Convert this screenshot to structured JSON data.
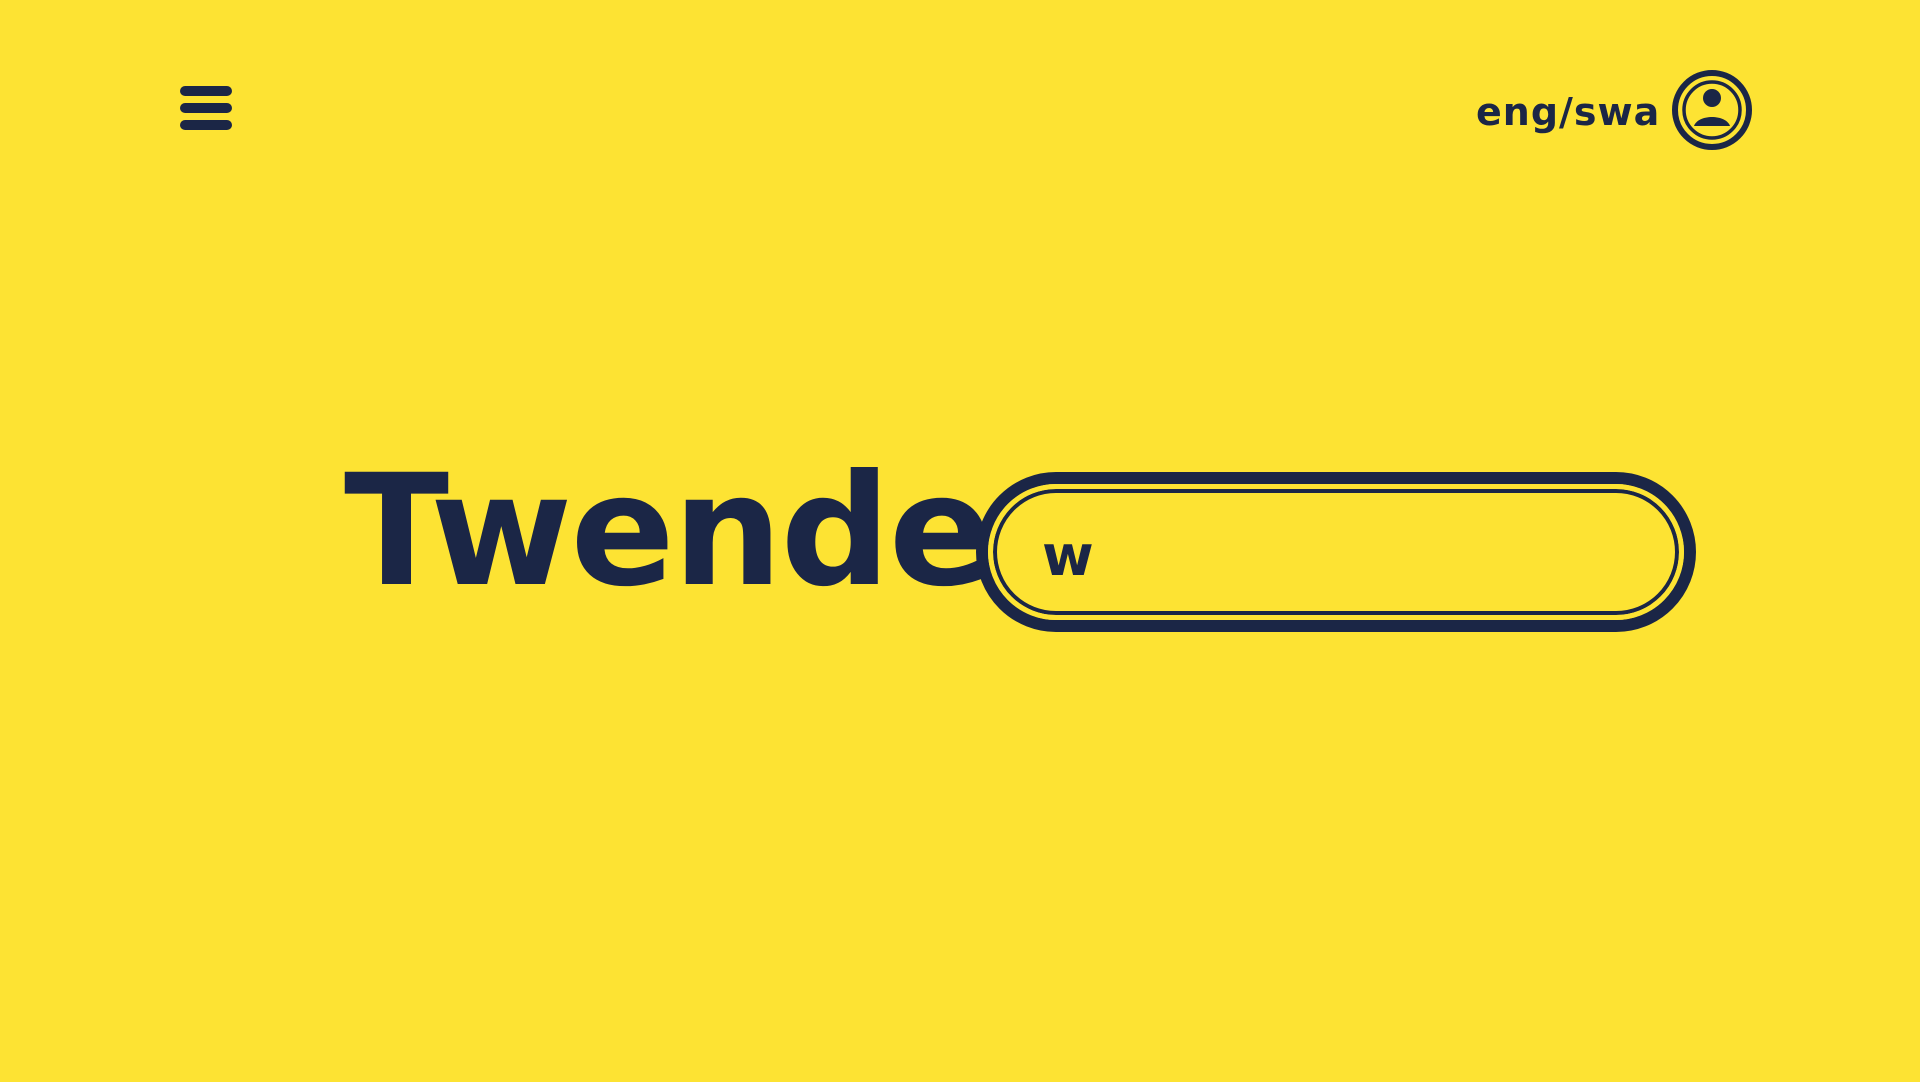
{
  "header": {
    "menu_icon": "hamburger-menu-icon",
    "language_toggle": "eng/swa",
    "account_icon": "user-circle-icon"
  },
  "hero": {
    "title": "Twende",
    "search": {
      "value": "w",
      "placeholder": ""
    }
  },
  "colors": {
    "background": "#FDE333",
    "foreground": "#1B2646"
  }
}
